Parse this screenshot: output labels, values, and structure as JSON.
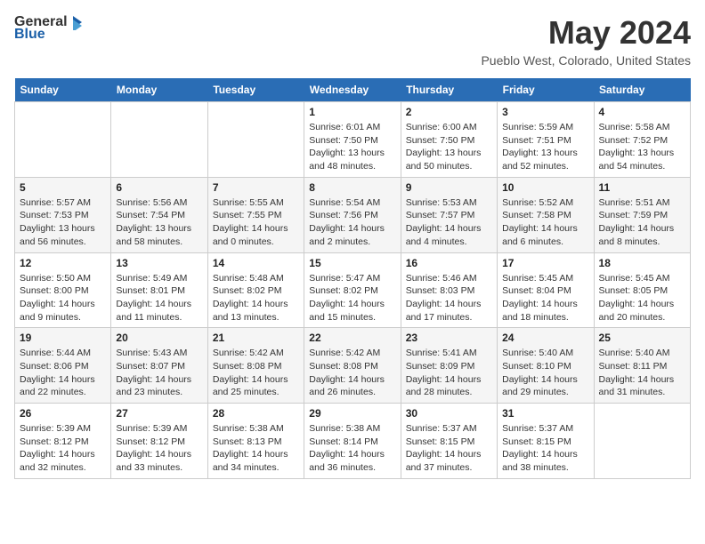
{
  "header": {
    "logo_general": "General",
    "logo_blue": "Blue",
    "month_title": "May 2024",
    "location": "Pueblo West, Colorado, United States"
  },
  "days_of_week": [
    "Sunday",
    "Monday",
    "Tuesday",
    "Wednesday",
    "Thursday",
    "Friday",
    "Saturday"
  ],
  "weeks": [
    [
      {
        "day": "",
        "info": ""
      },
      {
        "day": "",
        "info": ""
      },
      {
        "day": "",
        "info": ""
      },
      {
        "day": "1",
        "info": "Sunrise: 6:01 AM\nSunset: 7:50 PM\nDaylight: 13 hours\nand 48 minutes."
      },
      {
        "day": "2",
        "info": "Sunrise: 6:00 AM\nSunset: 7:50 PM\nDaylight: 13 hours\nand 50 minutes."
      },
      {
        "day": "3",
        "info": "Sunrise: 5:59 AM\nSunset: 7:51 PM\nDaylight: 13 hours\nand 52 minutes."
      },
      {
        "day": "4",
        "info": "Sunrise: 5:58 AM\nSunset: 7:52 PM\nDaylight: 13 hours\nand 54 minutes."
      }
    ],
    [
      {
        "day": "5",
        "info": "Sunrise: 5:57 AM\nSunset: 7:53 PM\nDaylight: 13 hours\nand 56 minutes."
      },
      {
        "day": "6",
        "info": "Sunrise: 5:56 AM\nSunset: 7:54 PM\nDaylight: 13 hours\nand 58 minutes."
      },
      {
        "day": "7",
        "info": "Sunrise: 5:55 AM\nSunset: 7:55 PM\nDaylight: 14 hours\nand 0 minutes."
      },
      {
        "day": "8",
        "info": "Sunrise: 5:54 AM\nSunset: 7:56 PM\nDaylight: 14 hours\nand 2 minutes."
      },
      {
        "day": "9",
        "info": "Sunrise: 5:53 AM\nSunset: 7:57 PM\nDaylight: 14 hours\nand 4 minutes."
      },
      {
        "day": "10",
        "info": "Sunrise: 5:52 AM\nSunset: 7:58 PM\nDaylight: 14 hours\nand 6 minutes."
      },
      {
        "day": "11",
        "info": "Sunrise: 5:51 AM\nSunset: 7:59 PM\nDaylight: 14 hours\nand 8 minutes."
      }
    ],
    [
      {
        "day": "12",
        "info": "Sunrise: 5:50 AM\nSunset: 8:00 PM\nDaylight: 14 hours\nand 9 minutes."
      },
      {
        "day": "13",
        "info": "Sunrise: 5:49 AM\nSunset: 8:01 PM\nDaylight: 14 hours\nand 11 minutes."
      },
      {
        "day": "14",
        "info": "Sunrise: 5:48 AM\nSunset: 8:02 PM\nDaylight: 14 hours\nand 13 minutes."
      },
      {
        "day": "15",
        "info": "Sunrise: 5:47 AM\nSunset: 8:02 PM\nDaylight: 14 hours\nand 15 minutes."
      },
      {
        "day": "16",
        "info": "Sunrise: 5:46 AM\nSunset: 8:03 PM\nDaylight: 14 hours\nand 17 minutes."
      },
      {
        "day": "17",
        "info": "Sunrise: 5:45 AM\nSunset: 8:04 PM\nDaylight: 14 hours\nand 18 minutes."
      },
      {
        "day": "18",
        "info": "Sunrise: 5:45 AM\nSunset: 8:05 PM\nDaylight: 14 hours\nand 20 minutes."
      }
    ],
    [
      {
        "day": "19",
        "info": "Sunrise: 5:44 AM\nSunset: 8:06 PM\nDaylight: 14 hours\nand 22 minutes."
      },
      {
        "day": "20",
        "info": "Sunrise: 5:43 AM\nSunset: 8:07 PM\nDaylight: 14 hours\nand 23 minutes."
      },
      {
        "day": "21",
        "info": "Sunrise: 5:42 AM\nSunset: 8:08 PM\nDaylight: 14 hours\nand 25 minutes."
      },
      {
        "day": "22",
        "info": "Sunrise: 5:42 AM\nSunset: 8:08 PM\nDaylight: 14 hours\nand 26 minutes."
      },
      {
        "day": "23",
        "info": "Sunrise: 5:41 AM\nSunset: 8:09 PM\nDaylight: 14 hours\nand 28 minutes."
      },
      {
        "day": "24",
        "info": "Sunrise: 5:40 AM\nSunset: 8:10 PM\nDaylight: 14 hours\nand 29 minutes."
      },
      {
        "day": "25",
        "info": "Sunrise: 5:40 AM\nSunset: 8:11 PM\nDaylight: 14 hours\nand 31 minutes."
      }
    ],
    [
      {
        "day": "26",
        "info": "Sunrise: 5:39 AM\nSunset: 8:12 PM\nDaylight: 14 hours\nand 32 minutes."
      },
      {
        "day": "27",
        "info": "Sunrise: 5:39 AM\nSunset: 8:12 PM\nDaylight: 14 hours\nand 33 minutes."
      },
      {
        "day": "28",
        "info": "Sunrise: 5:38 AM\nSunset: 8:13 PM\nDaylight: 14 hours\nand 34 minutes."
      },
      {
        "day": "29",
        "info": "Sunrise: 5:38 AM\nSunset: 8:14 PM\nDaylight: 14 hours\nand 36 minutes."
      },
      {
        "day": "30",
        "info": "Sunrise: 5:37 AM\nSunset: 8:15 PM\nDaylight: 14 hours\nand 37 minutes."
      },
      {
        "day": "31",
        "info": "Sunrise: 5:37 AM\nSunset: 8:15 PM\nDaylight: 14 hours\nand 38 minutes."
      },
      {
        "day": "",
        "info": ""
      }
    ]
  ]
}
